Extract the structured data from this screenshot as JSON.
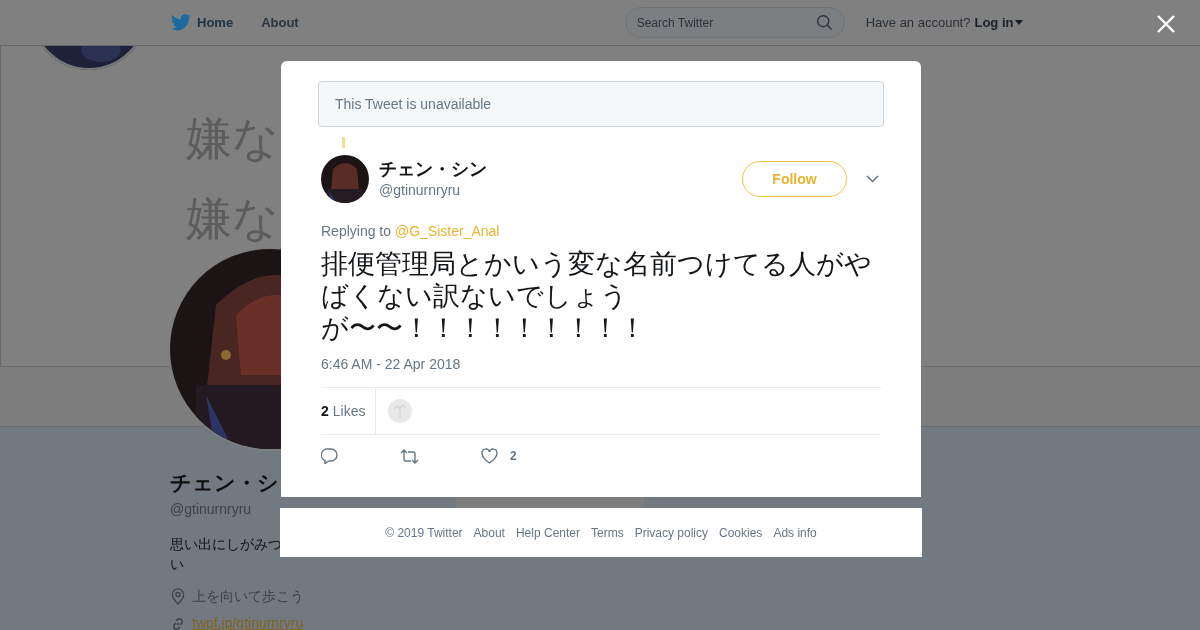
{
  "background_page": {
    "nav": {
      "items": [
        {
          "label": "Home",
          "selected": true
        },
        {
          "label": "About",
          "selected": false
        }
      ],
      "search": {
        "placeholder": "Search Twitter"
      },
      "account_prompt": "Have an account?",
      "login": "Log in"
    },
    "media_text": [
      "嫌な",
      "嫌な"
    ],
    "profile": {
      "name": "チェン・シ",
      "handle": "@gtinurnryru",
      "bio": [
        "思い出にしがみつ",
        "い"
      ],
      "location": "上を向いて歩こう",
      "url": "twpf.jp/gtinurnryru"
    }
  },
  "modal": {
    "notice": "This Tweet is unavailable",
    "author": {
      "name": "チェン・シン",
      "handle": "@gtinurnryru"
    },
    "follow_label": "Follow",
    "replying_label": "Replying to",
    "replying_to": "@G_Sister_Anal",
    "text_lines": [
      "排便管理局とかいう変な名前つけてる人がや",
      "ばくない訳ないでしょう",
      "が〜〜！！！！！！！！！"
    ],
    "timestamp": "6:46 AM - 22 Apr 2018",
    "likes_count": "2",
    "likes_label": "Likes",
    "actions": [
      {
        "kind": "reply"
      },
      {
        "kind": "retweet"
      },
      {
        "kind": "like",
        "count": "2"
      }
    ]
  },
  "footer": [
    "© 2019 Twitter",
    "About",
    "Help Center",
    "Terms",
    "Privacy policy",
    "Cookies",
    "Ads info"
  ]
}
